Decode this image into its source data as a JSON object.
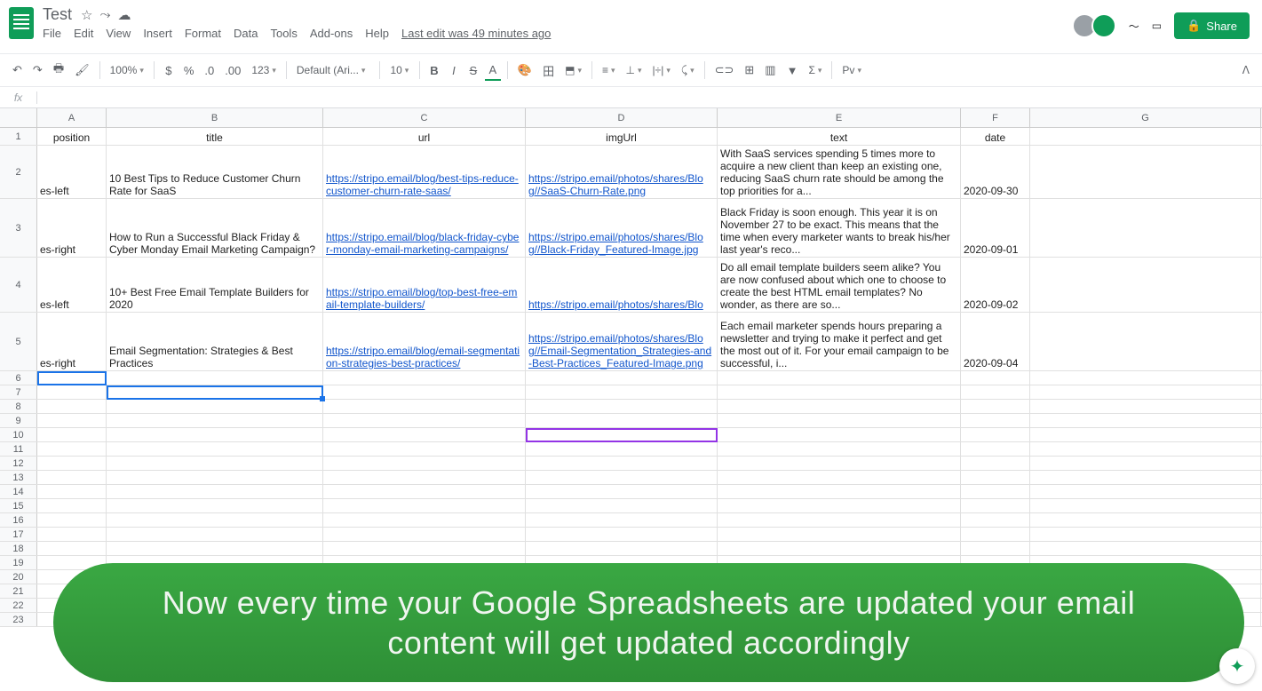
{
  "header": {
    "doc_title": "Test",
    "last_edit": "Last edit was 49 minutes ago",
    "share_label": "Share"
  },
  "menus": [
    "File",
    "Edit",
    "View",
    "Insert",
    "Format",
    "Data",
    "Tools",
    "Add-ons",
    "Help"
  ],
  "toolbar": {
    "zoom": "100%",
    "currency": "$",
    "percent": "%",
    "dec_minus": ".0",
    "dec_plus": ".00",
    "format_num": "123",
    "font": "Default (Ari...",
    "font_size": "10",
    "paint": "Pv"
  },
  "columns": [
    "A",
    "B",
    "C",
    "D",
    "E",
    "F",
    "G"
  ],
  "headers": {
    "A": "position",
    "B": "title",
    "C": "url",
    "D": "imgUrl",
    "E": "text",
    "F": "date"
  },
  "rows": [
    {
      "num": 2,
      "A": "es-left",
      "B": "10 Best Tips to Reduce Customer Churn Rate for SaaS",
      "C": "https://stripo.email/blog/best-tips-reduce-customer-churn-rate-saas/",
      "D": "https://stripo.email/photos/shares/Blog//SaaS-Churn-Rate.png",
      "E": "With SaaS services spending 5 times more to acquire a new client than keep an existing one, reducing SaaS churn rate should be among the top priorities for a...",
      "F": "2020-09-30"
    },
    {
      "num": 3,
      "A": "es-right",
      "B": "How to Run a Successful Black Friday & Cyber Monday Email Marketing Campaign?",
      "C": "https://stripo.email/blog/black-friday-cyber-monday-email-marketing-campaigns/",
      "D": "https://stripo.email/photos/shares/Blog//Black-Friday_Featured-Image.jpg",
      "E": "Black Friday is soon enough. This year it is on November 27 to be exact. This means that the time when every marketer wants to break his/her last year's reco...",
      "F": "2020-09-01"
    },
    {
      "num": 4,
      "A": "es-left",
      "B": "10+ Best Free Email Template Builders for 2020",
      "C": "https://stripo.email/blog/top-best-free-email-template-builders/",
      "D": "https://stripo.email/photos/shares/Blo",
      "E": "Do all email template builders seem alike? You are now confused about which one to choose to create the best HTML email templates? No wonder, as there are so...",
      "F": "2020-09-02"
    },
    {
      "num": 5,
      "A": "es-right",
      "B": "Email Segmentation: Strategies & Best Practices",
      "C": "https://stripo.email/blog/email-segmentation-strategies-best-practices/",
      "D": "https://stripo.email/photos/shares/Blog//Email-Segmentation_Strategies-and-Best-Practices_Featured-Image.png",
      "E": "Each email marketer spends hours preparing a newsletter and trying to make it perfect and get the most out of it. For your email campaign to be successful, i...",
      "F": "2020-09-04"
    }
  ],
  "overlay_text": "Now every time your Google Spreadsheets are updated your email content will get updated accordingly"
}
